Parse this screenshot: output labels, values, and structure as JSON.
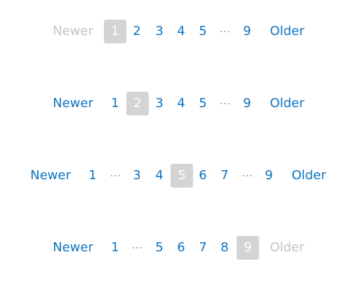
{
  "labels": {
    "newer": "Newer",
    "older": "Older",
    "ellipsis": "⋯"
  },
  "colors": {
    "link": "#0d74c0",
    "disabled": "#c4c4c4",
    "current_bg": "#d4d4d4",
    "current_text": "#ffffff",
    "ellipsis": "#9a9a9a"
  },
  "pagers": [
    {
      "current": "1",
      "newer_disabled": true,
      "older_disabled": false,
      "pages": [
        "1",
        "2",
        "3",
        "4",
        "5",
        "9"
      ]
    },
    {
      "current": "2",
      "newer_disabled": false,
      "older_disabled": false,
      "pages": [
        "1",
        "2",
        "3",
        "4",
        "5",
        "9"
      ]
    },
    {
      "current": "5",
      "newer_disabled": false,
      "older_disabled": false,
      "pages": [
        "1",
        "3",
        "4",
        "5",
        "6",
        "7",
        "9"
      ]
    },
    {
      "current": "9",
      "newer_disabled": false,
      "older_disabled": true,
      "pages": [
        "1",
        "5",
        "6",
        "7",
        "8",
        "9"
      ]
    }
  ]
}
